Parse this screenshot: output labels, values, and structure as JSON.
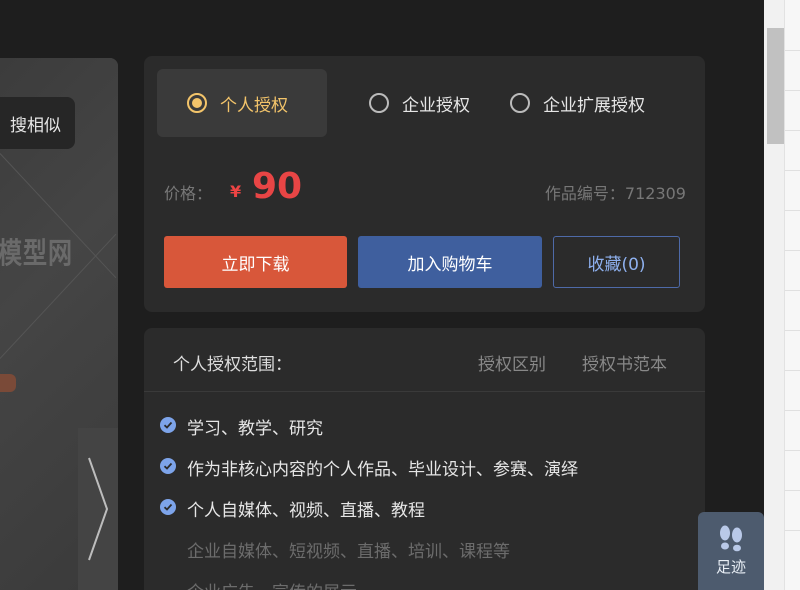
{
  "left_panel": {
    "search_similar_label": "搜相似",
    "watermark_text": "模型网"
  },
  "license": {
    "tabs": [
      {
        "label": "个人授权",
        "selected": true
      },
      {
        "label": "企业授权",
        "selected": false
      },
      {
        "label": "企业扩展授权",
        "selected": false
      }
    ],
    "price_label": "价格：",
    "currency": "¥",
    "price": "90",
    "work_id_label": "作品编号：712309",
    "download_label": "立即下载",
    "cart_label": "加入购物车",
    "favorite_label": "收藏(0)"
  },
  "scope": {
    "title": "个人授权范围：",
    "link_diff": "授权区别",
    "link_sample": "授权书范本",
    "items": [
      {
        "text": "学习、教学、研究",
        "included": true
      },
      {
        "text": "作为非核心内容的个人作品、毕业设计、参赛、演绎",
        "included": true
      },
      {
        "text": "个人自媒体、视频、直播、教程",
        "included": true
      },
      {
        "text": "企业自媒体、短视频、直播、培训、课程等",
        "included": false
      },
      {
        "text": "企业广告、宣传的展示",
        "included": false
      }
    ]
  },
  "footprint": {
    "label": "足迹"
  },
  "colors": {
    "accent_selected": "#f3c46a",
    "price": "#e84545",
    "download_button": "#d8573a",
    "cart_button": "#3f5f9e",
    "check": "#7da4ea"
  }
}
